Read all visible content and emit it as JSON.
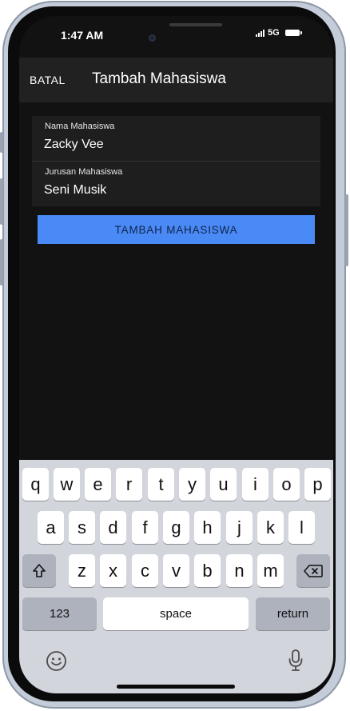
{
  "status_bar": {
    "time": "1:47 AM",
    "network": "5G"
  },
  "app_bar": {
    "cancel_label": "BATAL",
    "title": "Tambah Mahasiswa"
  },
  "form": {
    "name_label": "Nama Mahasiswa",
    "name_value": "Zacky Vee",
    "major_label": "Jurusan Mahasiswa",
    "major_value": "Seni Musik",
    "submit_label": "TAMBAH MAHASISWA",
    "submit_color": "#4a8af6"
  },
  "keyboard": {
    "row1": [
      "q",
      "w",
      "e",
      "r",
      "t",
      "y",
      "u",
      "i",
      "o",
      "p"
    ],
    "row2": [
      "a",
      "s",
      "d",
      "f",
      "g",
      "h",
      "j",
      "k",
      "l"
    ],
    "row3": [
      "z",
      "x",
      "c",
      "v",
      "b",
      "n",
      "m"
    ],
    "numbers_label": "123",
    "space_label": "space",
    "return_label": "return",
    "shift_icon": "shift-arrow-icon",
    "delete_icon": "backspace-icon",
    "emoji_icon": "emoji-icon",
    "mic_icon": "microphone-icon"
  }
}
